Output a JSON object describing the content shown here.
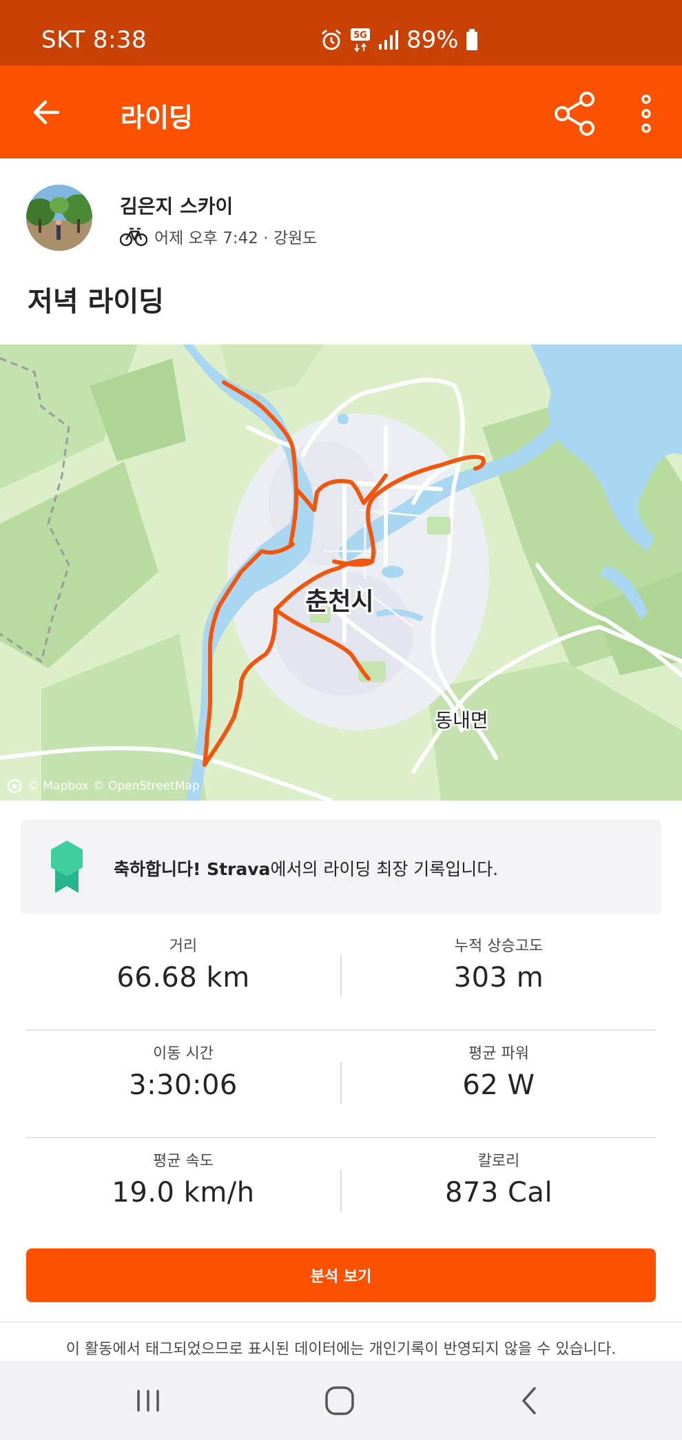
{
  "status_bar": {
    "carrier_time": "SKT 8:38",
    "network_label": "5G",
    "battery_percent": "89%",
    "icons": [
      "alarm-icon",
      "5g-icon",
      "signal-icon",
      "battery-icon"
    ]
  },
  "app_bar": {
    "title": "라이딩",
    "icons": [
      "back-arrow-icon",
      "share-icon",
      "more-vertical-icon"
    ]
  },
  "athlete": {
    "name": "김은지 스카이",
    "meta": "어제 오후 7:42 · 강원도",
    "activity_icon": "bicycle-icon"
  },
  "activity": {
    "title": "저녁 라이딩"
  },
  "map": {
    "city_label": "춘천시",
    "district_label": "동내면",
    "attribution": "© Mapbox © OpenStreetMap",
    "route_color": "#f2560e",
    "water_color": "#a9d7f2"
  },
  "achievement": {
    "icon": "medal-icon",
    "bold_prefix": "축하합니다! Strava",
    "message_rest": "에서의 라이딩 최장 기록입니다."
  },
  "stats": [
    {
      "left": {
        "label": "거리",
        "value": "66.68 km"
      },
      "right": {
        "label": "누적 상승고도",
        "value": "303 m"
      }
    },
    {
      "left": {
        "label": "이동 시간",
        "value": "3:30:06"
      },
      "right": {
        "label": "평균 파워",
        "value": "62 W"
      }
    },
    {
      "left": {
        "label": "평균 속도",
        "value": "19.0 km/h"
      },
      "right": {
        "label": "칼로리",
        "value": "873 Cal"
      }
    }
  ],
  "analyze_button": "분석 보기",
  "footnote": "이 활동에서 태그되었으므로 표시된 데이터에는 개인기록이 반영되지 않을 수 있습니다.",
  "colors": {
    "brand_orange": "#fc5200",
    "status_bar": "#c94204"
  }
}
